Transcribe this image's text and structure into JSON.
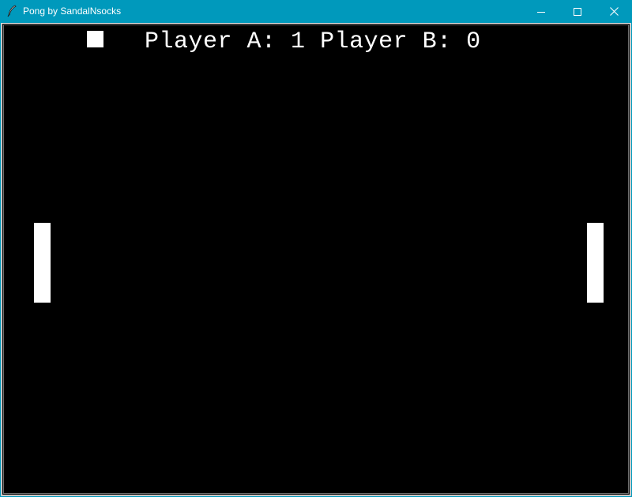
{
  "window": {
    "title": "Pong by SandalNsocks",
    "app_icon": "feather-icon",
    "controls": {
      "minimize": "minimize-icon",
      "maximize": "maximize-icon",
      "close": "close-icon"
    },
    "titlebar_color": "#0099bc"
  },
  "game": {
    "score": {
      "player_a_label": "Player A:",
      "player_a_score": "1",
      "player_b_label": "Player B:",
      "player_b_score": "0"
    },
    "colors": {
      "background": "#000000",
      "objects": "#ffffff"
    }
  }
}
